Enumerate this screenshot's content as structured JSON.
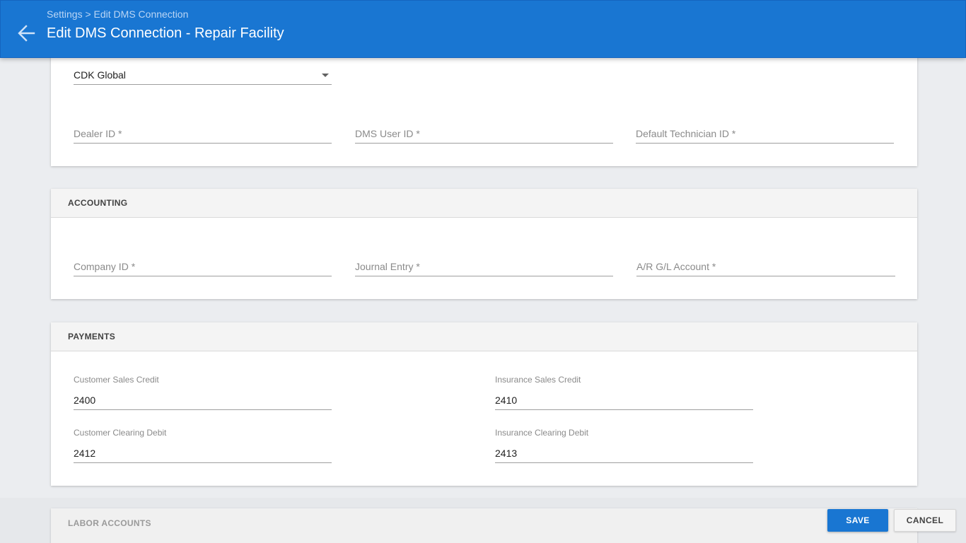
{
  "header": {
    "breadcrumb": "Settings > Edit DMS Connection",
    "title": "Edit DMS Connection - Repair Facility",
    "back_icon": "arrow-left-icon"
  },
  "connection": {
    "provider_value": "CDK Global",
    "dealer_id_placeholder": "Dealer ID *",
    "dms_user_id_placeholder": "DMS User ID *",
    "default_technician_id_placeholder": "Default Technician ID *"
  },
  "accounting": {
    "title": "ACCOUNTING",
    "company_id_placeholder": "Company ID *",
    "journal_entry_placeholder": "Journal Entry *",
    "ar_gl_account_placeholder": "A/R G/L Account *"
  },
  "payments": {
    "title": "PAYMENTS",
    "customer_sales_credit_label": "Customer Sales Credit",
    "customer_sales_credit_value": "2400",
    "insurance_sales_credit_label": "Insurance Sales Credit",
    "insurance_sales_credit_value": "2410",
    "customer_clearing_debit_label": "Customer Clearing Debit",
    "customer_clearing_debit_value": "2412",
    "insurance_clearing_debit_label": "Insurance Clearing Debit",
    "insurance_clearing_debit_value": "2413"
  },
  "labor_accounts": {
    "title": "LABOR ACCOUNTS"
  },
  "actions": {
    "save_label": "SAVE",
    "cancel_label": "CANCEL"
  },
  "colors": {
    "primary": "#1976d2",
    "background": "#ebedf0"
  }
}
